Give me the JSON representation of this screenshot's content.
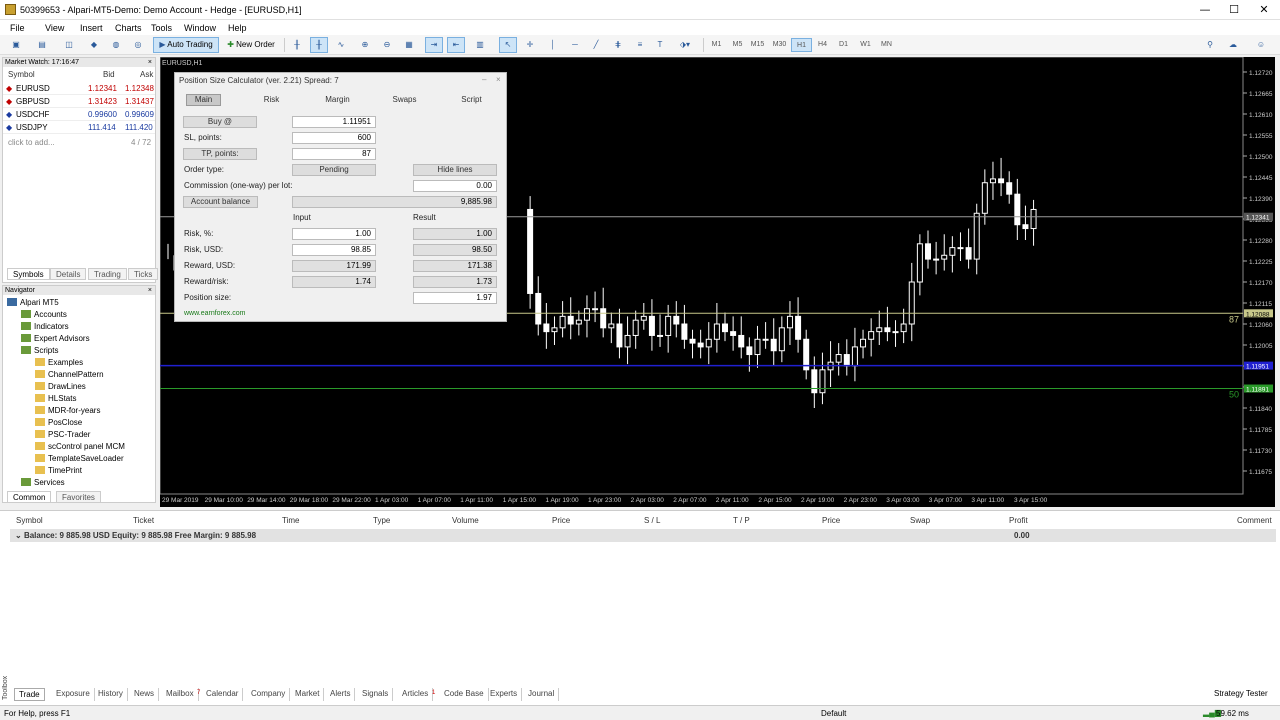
{
  "window": {
    "title": "50399653 - Alpari-MT5-Demo: Demo Account - Hedge - [EURUSD,H1]",
    "minimize": "—",
    "maximize": "☐",
    "close": "✕"
  },
  "menu": [
    "File",
    "View",
    "Insert",
    "Charts",
    "Tools",
    "Window",
    "Help"
  ],
  "toolbar": {
    "auto_trading": "Auto Trading",
    "new_order": "New Order",
    "timeframes": [
      "M1",
      "M5",
      "M15",
      "M30",
      "H1",
      "H4",
      "D1",
      "W1",
      "MN"
    ],
    "active_tf": "H1"
  },
  "market_watch": {
    "title": "Market Watch: 17:16:47",
    "cols": [
      "Symbol",
      "Bid",
      "Ask"
    ],
    "rows": [
      {
        "symbol": "EURUSD",
        "bid": "1.12341",
        "ask": "1.12348",
        "color": "#c00000"
      },
      {
        "symbol": "GBPUSD",
        "bid": "1.31423",
        "ask": "1.31437",
        "color": "#c00000"
      },
      {
        "symbol": "USDCHF",
        "bid": "0.99600",
        "ask": "0.99609",
        "color": "#1a3aa0"
      },
      {
        "symbol": "USDJPY",
        "bid": "111.414",
        "ask": "111.420",
        "color": "#1a3aa0"
      }
    ],
    "add": "click to add...",
    "count": "4 / 72",
    "tabs": [
      "Symbols",
      "Details",
      "Trading",
      "Ticks"
    ]
  },
  "navigator": {
    "title": "Navigator",
    "items": [
      {
        "label": "Alpari MT5",
        "level": 0
      },
      {
        "label": "Accounts",
        "level": 1
      },
      {
        "label": "Indicators",
        "level": 1
      },
      {
        "label": "Expert Advisors",
        "level": 1
      },
      {
        "label": "Scripts",
        "level": 1
      },
      {
        "label": "Examples",
        "level": 2
      },
      {
        "label": "ChannelPattern",
        "level": 2
      },
      {
        "label": "DrawLines",
        "level": 2
      },
      {
        "label": "HLStats",
        "level": 2
      },
      {
        "label": "MDR-for-years",
        "level": 2
      },
      {
        "label": "PosClose",
        "level": 2
      },
      {
        "label": "PSC-Trader",
        "level": 2
      },
      {
        "label": "scControl panel MCM",
        "level": 2
      },
      {
        "label": "TemplateSaveLoader",
        "level": 2
      },
      {
        "label": "TimePrint",
        "level": 2
      },
      {
        "label": "Services",
        "level": 1
      }
    ],
    "tabs": [
      "Common",
      "Favorites"
    ]
  },
  "chart": {
    "symbol_label": "EURUSD,H1",
    "price_ticks": [
      "1.12720",
      "1.12665",
      "1.12610",
      "1.12555",
      "1.12500",
      "1.12445",
      "1.12390",
      "1.12335",
      "1.12280",
      "1.12225",
      "1.12170",
      "1.12115",
      "1.12060",
      "1.12005",
      "1.11950",
      "1.11895",
      "1.11840",
      "1.11785",
      "1.11730",
      "1.11675"
    ],
    "time_ticks": [
      "29 Mar 2019",
      "29 Mar 10:00",
      "29 Mar 14:00",
      "29 Mar 18:00",
      "29 Mar 22:00",
      "1 Apr 03:00",
      "1 Apr 07:00",
      "1 Apr 11:00",
      "1 Apr 15:00",
      "1 Apr 19:00",
      "1 Apr 23:00",
      "2 Apr 03:00",
      "2 Apr 07:00",
      "2 Apr 11:00",
      "2 Apr 15:00",
      "2 Apr 19:00",
      "2 Apr 23:00",
      "3 Apr 03:00",
      "3 Apr 07:00",
      "3 Apr 11:00",
      "3 Apr 15:00"
    ],
    "tp_label": "87",
    "sl_label": "50",
    "tp_price": "1.12088",
    "entry_price": "1.11951",
    "sl_price": "1.11891",
    "current_price": "1.12341"
  },
  "calculator": {
    "title": "Position Size Calculator (ver. 2.21) Spread: 7",
    "tabs": [
      "Main",
      "Risk",
      "Margin",
      "Swaps",
      "Script"
    ],
    "buy_label": "Buy @",
    "entry": "1.11951",
    "sl_label": "SL, points:",
    "sl": "600",
    "tp_label": "TP, points:",
    "tp": "87",
    "order_type_label": "Order type:",
    "pending": "Pending",
    "hide_lines": "Hide lines",
    "commission_label": "Commission (one-way) per lot:",
    "commission": "0.00",
    "account_balance_label": "Account balance",
    "account_balance": "9,885.98",
    "input_header": "Input",
    "result_header": "Result",
    "risk_pct_label": "Risk, %:",
    "risk_pct_in": "1.00",
    "risk_pct_res": "1.00",
    "risk_usd_label": "Risk, USD:",
    "risk_usd_in": "98.85",
    "risk_usd_res": "98.50",
    "reward_usd_label": "Reward, USD:",
    "reward_usd_in": "171.99",
    "reward_usd_res": "171.38",
    "rr_label": "Reward/risk:",
    "rr_in": "1.74",
    "rr_res": "1.73",
    "pos_size_label": "Position size:",
    "pos_size": "1.97",
    "link": "www.earnforex.com"
  },
  "terminal": {
    "cols": [
      "Symbol",
      "Ticket",
      "Time",
      "Type",
      "Volume",
      "Price",
      "S / L",
      "T / P",
      "Price",
      "Swap",
      "Profit",
      "Comment"
    ],
    "balance_row": "Balance: 9 885.98 USD  Equity: 9 885.98  Free Margin: 9 885.98",
    "profit": "0.00",
    "tabs": [
      "Trade",
      "Exposure",
      "History",
      "News",
      "Mailbox",
      "Calendar",
      "Company",
      "Market",
      "Alerts",
      "Signals",
      "Articles",
      "Code Base",
      "Experts",
      "Journal"
    ],
    "mailbox_badge": "7",
    "articles_badge": "1",
    "strategy_tester": "Strategy Tester",
    "toolbox": "Toolbox"
  },
  "status": {
    "help": "For Help, press F1",
    "profile": "Default",
    "ping": "59.62 ms"
  }
}
